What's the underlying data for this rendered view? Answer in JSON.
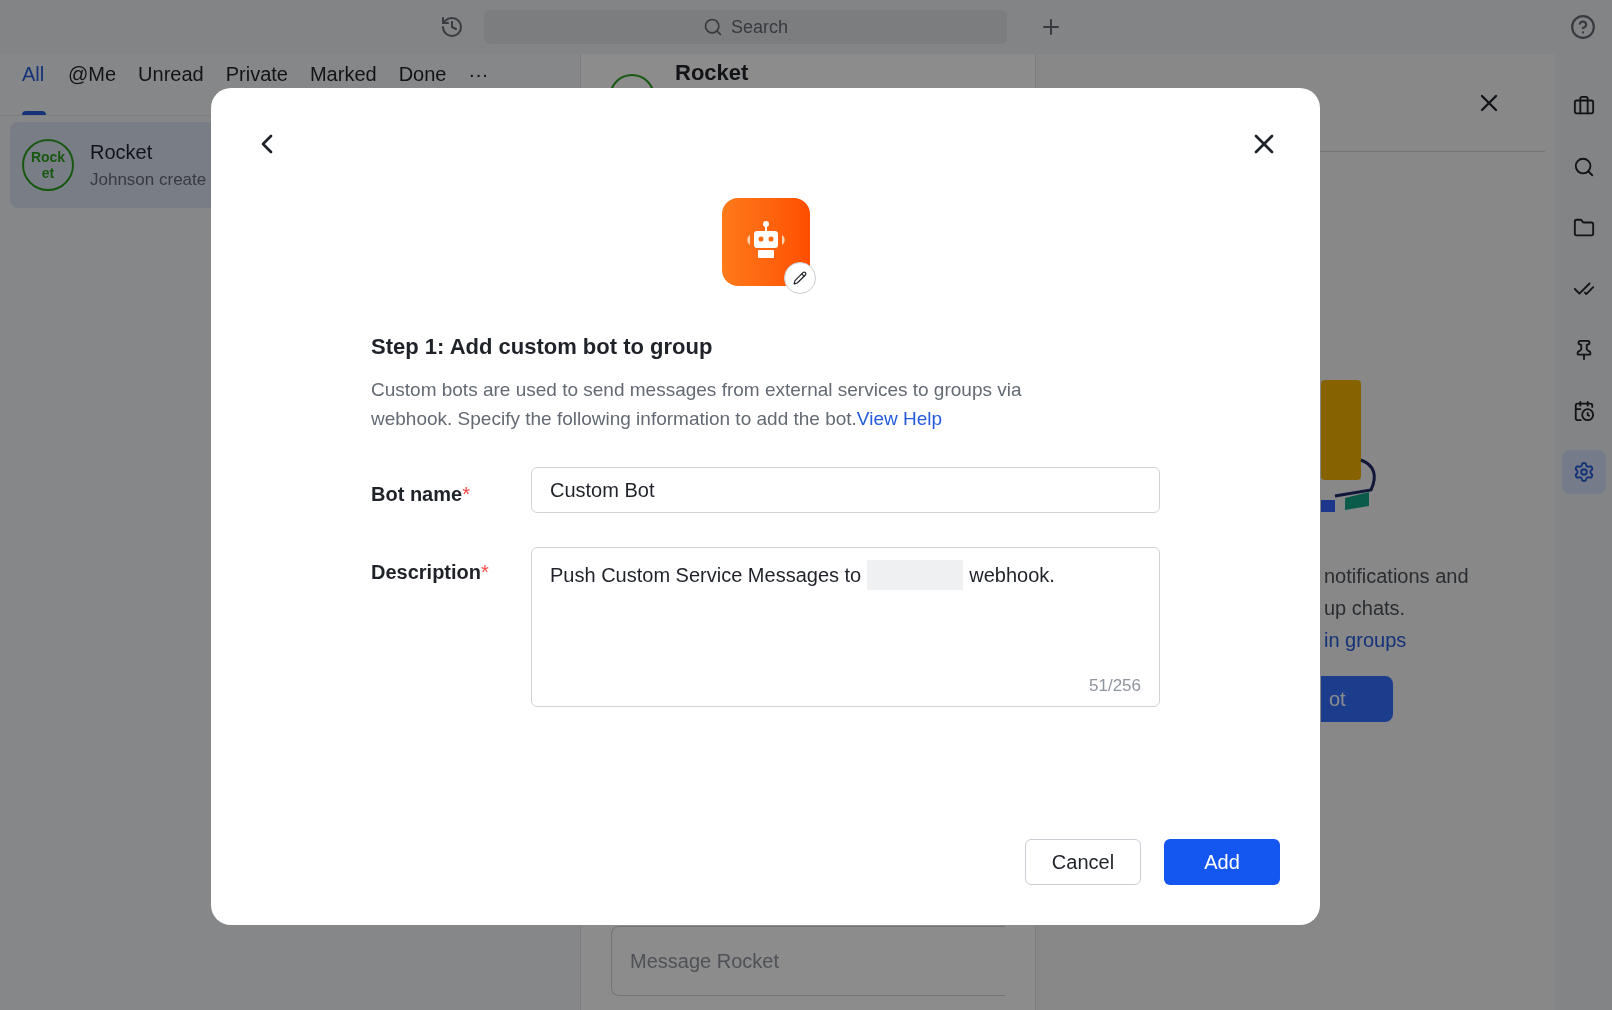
{
  "top_bar": {
    "search": {
      "placeholder": "Search"
    }
  },
  "chat_tabs": [
    {
      "label": "All",
      "selected": true
    },
    {
      "label": "@Me",
      "selected": false
    },
    {
      "label": "Unread",
      "selected": false
    },
    {
      "label": "Private",
      "selected": false
    },
    {
      "label": "Marked",
      "selected": false
    },
    {
      "label": "Done",
      "selected": false
    },
    {
      "label": "···",
      "selected": false
    }
  ],
  "chats": [
    {
      "avatar": "Rock et",
      "name": "Rocket",
      "preview": "Johnson create",
      "selected": true
    }
  ],
  "chat_header": {
    "title": "Rocket"
  },
  "message_input": {
    "placeholder": "Message Rocket"
  },
  "side_panel": {
    "lines": [
      "notifications and",
      "up chats."
    ],
    "link": "in groups",
    "button": "ot"
  },
  "sidebar_icons": [
    {
      "kind": "briefcase",
      "selected": false
    },
    {
      "kind": "search",
      "selected": false
    },
    {
      "kind": "folder",
      "selected": false
    },
    {
      "kind": "check",
      "selected": false
    },
    {
      "kind": "pin",
      "selected": false
    },
    {
      "kind": "calendar",
      "selected": false
    },
    {
      "kind": "settings",
      "selected": true
    }
  ],
  "dialog": {
    "title": "Step 1: Add custom bot to group",
    "description": "Custom bots are used to send messages from external services to groups via webhook. Specify the following information to add the bot.",
    "help_link": "View Help",
    "fields": [
      {
        "kind": "input",
        "label": "Bot name",
        "required_mark": "*",
        "value": "Custom Bot"
      },
      {
        "kind": "textarea",
        "label": "Description",
        "required_mark": "*",
        "value_before": "Push Custom Service Messages to",
        "value_after": "webhook.",
        "redacted": true,
        "count": "51/256"
      }
    ],
    "buttons": [
      {
        "label": "Cancel",
        "kind": "secondary"
      },
      {
        "label": "Add",
        "kind": "primary"
      }
    ]
  }
}
